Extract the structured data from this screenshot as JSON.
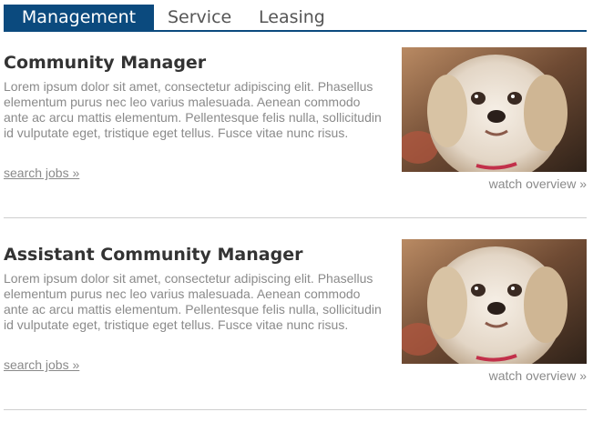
{
  "tabs": [
    {
      "label": "Management",
      "active": true
    },
    {
      "label": "Service",
      "active": false
    },
    {
      "label": "Leasing",
      "active": false
    }
  ],
  "colors": {
    "accent": "#0b4a7e",
    "text_dark": "#333333",
    "text_muted": "#8a8a8a",
    "divider": "#cfcfcf"
  },
  "jobs": [
    {
      "title": "Community Manager",
      "description": "Lorem ipsum dolor sit amet, consectetur adipiscing elit. Phasellus elementum purus nec leo varius malesuada. Aenean commodo ante ac arcu mattis elementum. Pellentesque felis nulla, sollicitudin id vulputate eget, tristique eget tellus. Fusce vitae nunc risus.",
      "search_label": "search jobs »",
      "watch_label": "watch overview »",
      "image_icon": "dog-photo"
    },
    {
      "title": "Assistant Community Manager",
      "description": "Lorem ipsum dolor sit amet, consectetur adipiscing elit. Phasellus elementum purus nec leo varius malesuada. Aenean commodo ante ac arcu mattis elementum. Pellentesque felis nulla, sollicitudin id vulputate eget, tristique eget tellus. Fusce vitae nunc risus.",
      "search_label": "search jobs »",
      "watch_label": "watch overview »",
      "image_icon": "dog-photo"
    }
  ]
}
